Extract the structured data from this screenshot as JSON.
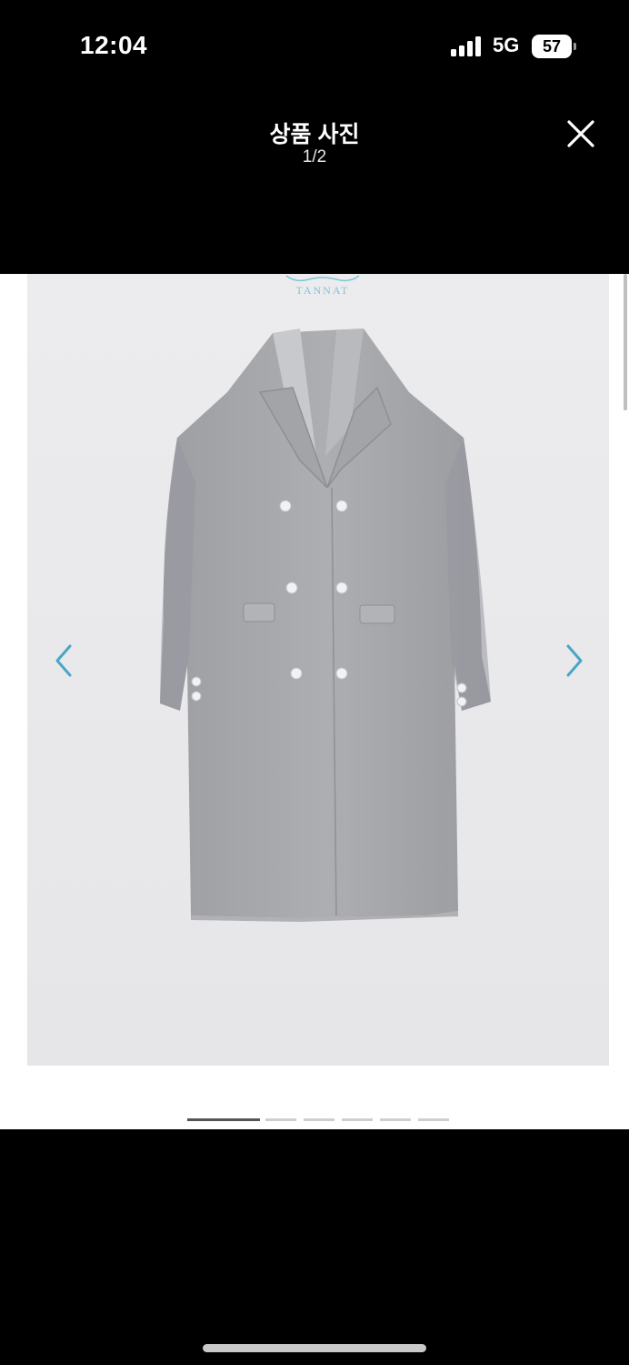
{
  "status_bar": {
    "time": "12:04",
    "network": "5G",
    "battery": "57"
  },
  "viewer": {
    "title": "상품 사진",
    "counter": "1/2"
  },
  "photo": {
    "brand": "TANNAT",
    "brand_color": "#7fc6d6",
    "subject": "gray double-breasted wool coat"
  },
  "gallery": {
    "page_count": 6,
    "active_index": 0
  },
  "colors": {
    "background": "#000000",
    "photo_background": "#ecebed",
    "arrow_color": "#4aa6c6",
    "coat_gray": "#a7a8ac"
  }
}
